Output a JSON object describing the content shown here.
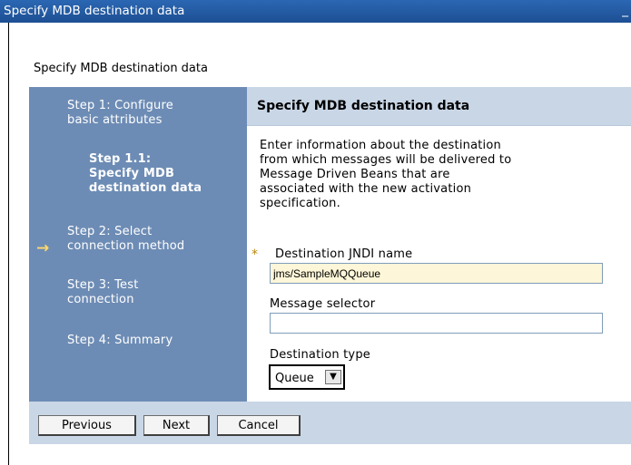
{
  "window": {
    "title": "Specify MDB destination data",
    "minimize_glyph": "_"
  },
  "page": {
    "heading": "Specify MDB destination data"
  },
  "steps": [
    {
      "line1": "Step  1:  Configure",
      "line2": "basic attributes"
    },
    {
      "line1": "Step  1.1:",
      "line2": "Specify MDB",
      "line3": "destination data"
    },
    {
      "line1": "Step  2:  Select",
      "line2": "connection method"
    },
    {
      "line1": "Step  3:  Test",
      "line2": "connection"
    },
    {
      "line1": "Step  4:  Summary"
    }
  ],
  "current_step_marker": "→",
  "panel": {
    "title": "Specify MDB destination data",
    "description": [
      "Enter information about the destination",
      "from which messages will be delivered to",
      "Message Driven Beans that are",
      "associated with the new activation",
      "specification."
    ],
    "required_marker": "*",
    "destination_jndi": {
      "label": "Destination JNDI name",
      "value": "jms/SampleMQQueue"
    },
    "message_selector": {
      "label": "Message selector",
      "value": ""
    },
    "destination_type": {
      "label": "Destination type",
      "selected": "Queue",
      "dropdown_glyph": "▼"
    }
  },
  "buttons": {
    "previous": "Previous",
    "next": "Next",
    "cancel": "Cancel"
  },
  "colors": {
    "titlebar": "#215ba5",
    "steps_panel": "#6d8cb5",
    "panel_header": "#c9d6e6",
    "required_field": "#fdf6d8",
    "current_step_arrow": "#ffd86b"
  }
}
